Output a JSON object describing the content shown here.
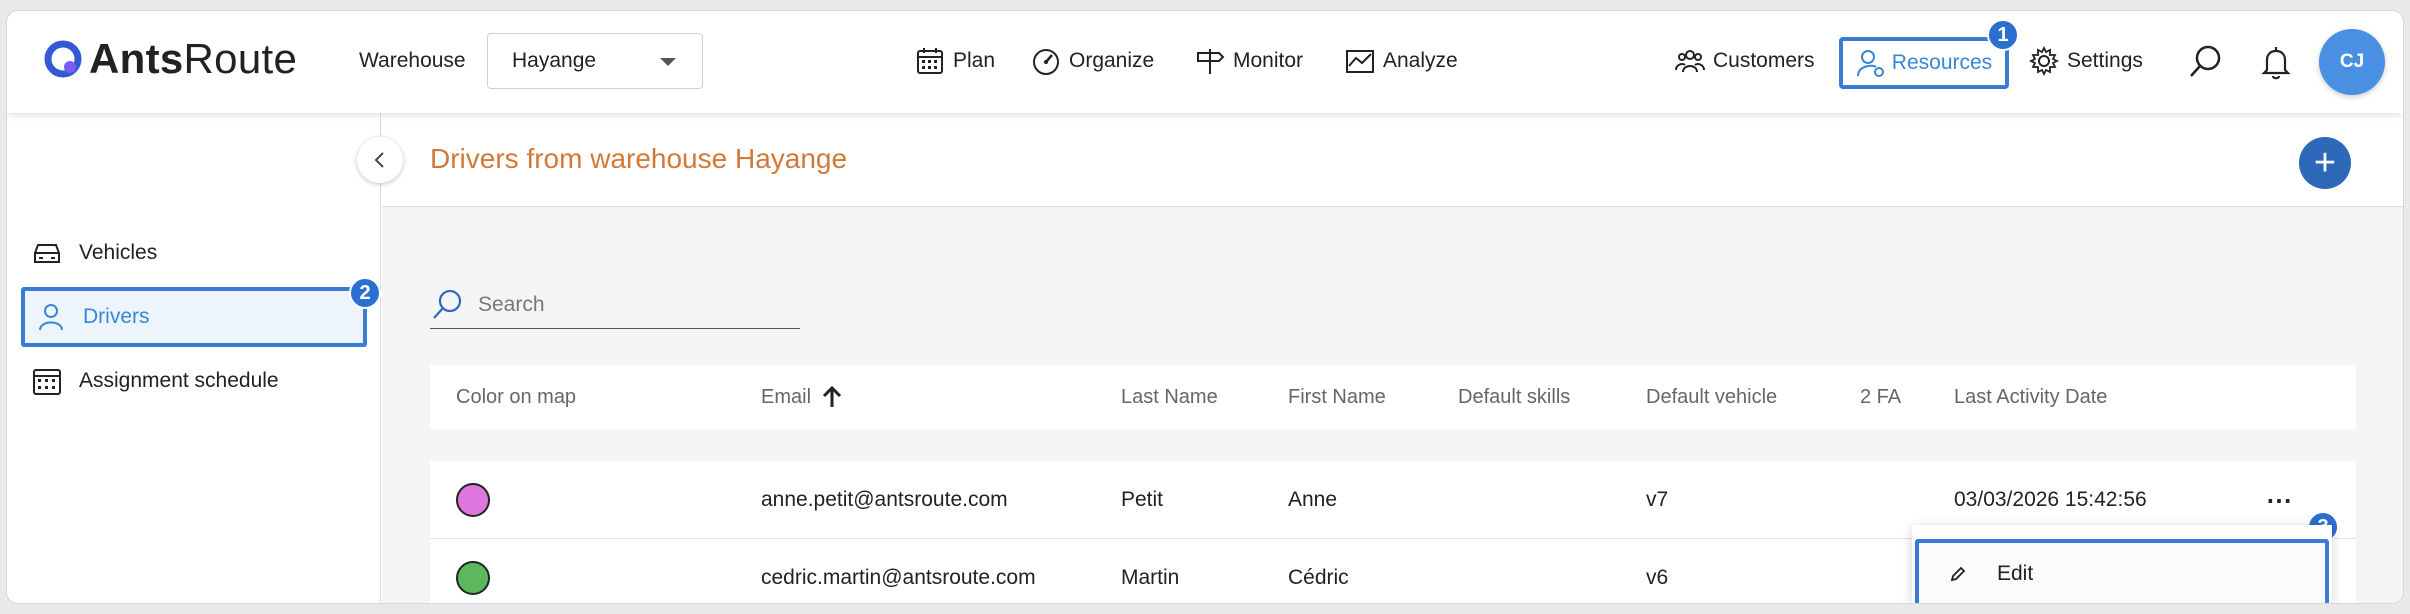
{
  "app": {
    "logo_text_bold": "Ants",
    "logo_text_light": "Route"
  },
  "warehouse": {
    "label": "Warehouse",
    "selected": "Hayange"
  },
  "nav": {
    "plan": "Plan",
    "organize": "Organize",
    "monitor": "Monitor",
    "analyze": "Analyze",
    "customers": "Customers",
    "resources": "Resources",
    "settings": "Settings"
  },
  "user": {
    "initials": "CJ"
  },
  "badges": {
    "one": "1",
    "two": "2",
    "three": "3"
  },
  "sidebar": {
    "items": [
      {
        "label": "Vehicles",
        "icon": "car-icon"
      },
      {
        "label": "Drivers",
        "icon": "user-icon"
      },
      {
        "label": "Assignment schedule",
        "icon": "calendar-icon"
      }
    ]
  },
  "page": {
    "title": "Drivers from warehouse Hayange"
  },
  "search": {
    "placeholder": "Search"
  },
  "table": {
    "columns": [
      "Color on map",
      "Email",
      "Last Name",
      "First Name",
      "Default skills",
      "Default vehicle",
      "2 FA",
      "Last Activity Date"
    ],
    "sort": {
      "column": "Email",
      "direction": "ascending"
    },
    "rows": [
      {
        "color": "#dd77dd",
        "email": "anne.petit@antsroute.com",
        "last_name": "Petit",
        "first_name": "Anne",
        "skills": "",
        "vehicle": "v7",
        "two_fa": "",
        "last_activity": "03/03/2026 15:42:56",
        "more": "⋯"
      },
      {
        "color": "#5cb85c",
        "email": "cedric.martin@antsroute.com",
        "last_name": "Martin",
        "first_name": "Cédric",
        "skills": "",
        "vehicle": "v6",
        "two_fa": "",
        "last_activity": ""
      }
    ]
  },
  "row_menu": {
    "edit": "Edit"
  },
  "colors": {
    "accent": "#3a7bd5",
    "title": "#d2793a",
    "add_button": "#2d69b8",
    "avatar": "#4a90e2"
  }
}
